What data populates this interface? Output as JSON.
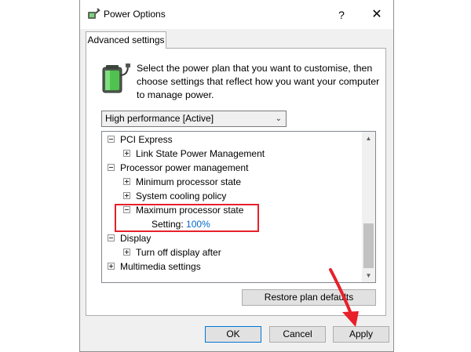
{
  "window": {
    "title": "Power Options",
    "help_glyph": "?",
    "close_glyph": "✕",
    "app_icon": "power-options-icon"
  },
  "tab": {
    "label": "Advanced settings"
  },
  "description": "Select the power plan that you want to customise, then choose settings that reflect how you want your computer to manage power.",
  "plan_select": {
    "value": "High performance [Active]",
    "chevron": "⌄"
  },
  "tree": {
    "items": [
      {
        "label": "PCI Express",
        "expander": "minus"
      },
      {
        "label": "Link State Power Management",
        "expander": "plus"
      },
      {
        "label": "Processor power management",
        "expander": "minus"
      },
      {
        "label": "Minimum processor state",
        "expander": "plus"
      },
      {
        "label": "System cooling policy",
        "expander": "plus"
      },
      {
        "label": "Maximum processor state",
        "expander": "minus"
      },
      {
        "label": "Setting:",
        "value": "100%"
      },
      {
        "label": "Display",
        "expander": "minus"
      },
      {
        "label": "Turn off display after",
        "expander": "plus"
      },
      {
        "label": "Multimedia settings",
        "expander": "plus"
      }
    ],
    "scroll_up": "▲",
    "scroll_down": "▼"
  },
  "buttons": {
    "restore": "Restore plan defaults",
    "ok": "OK",
    "cancel": "Cancel",
    "apply": "Apply"
  },
  "annotation": {
    "color": "#e8202a"
  },
  "colors": {
    "setting_value": "#0066cc",
    "accent": "#0078d7"
  }
}
